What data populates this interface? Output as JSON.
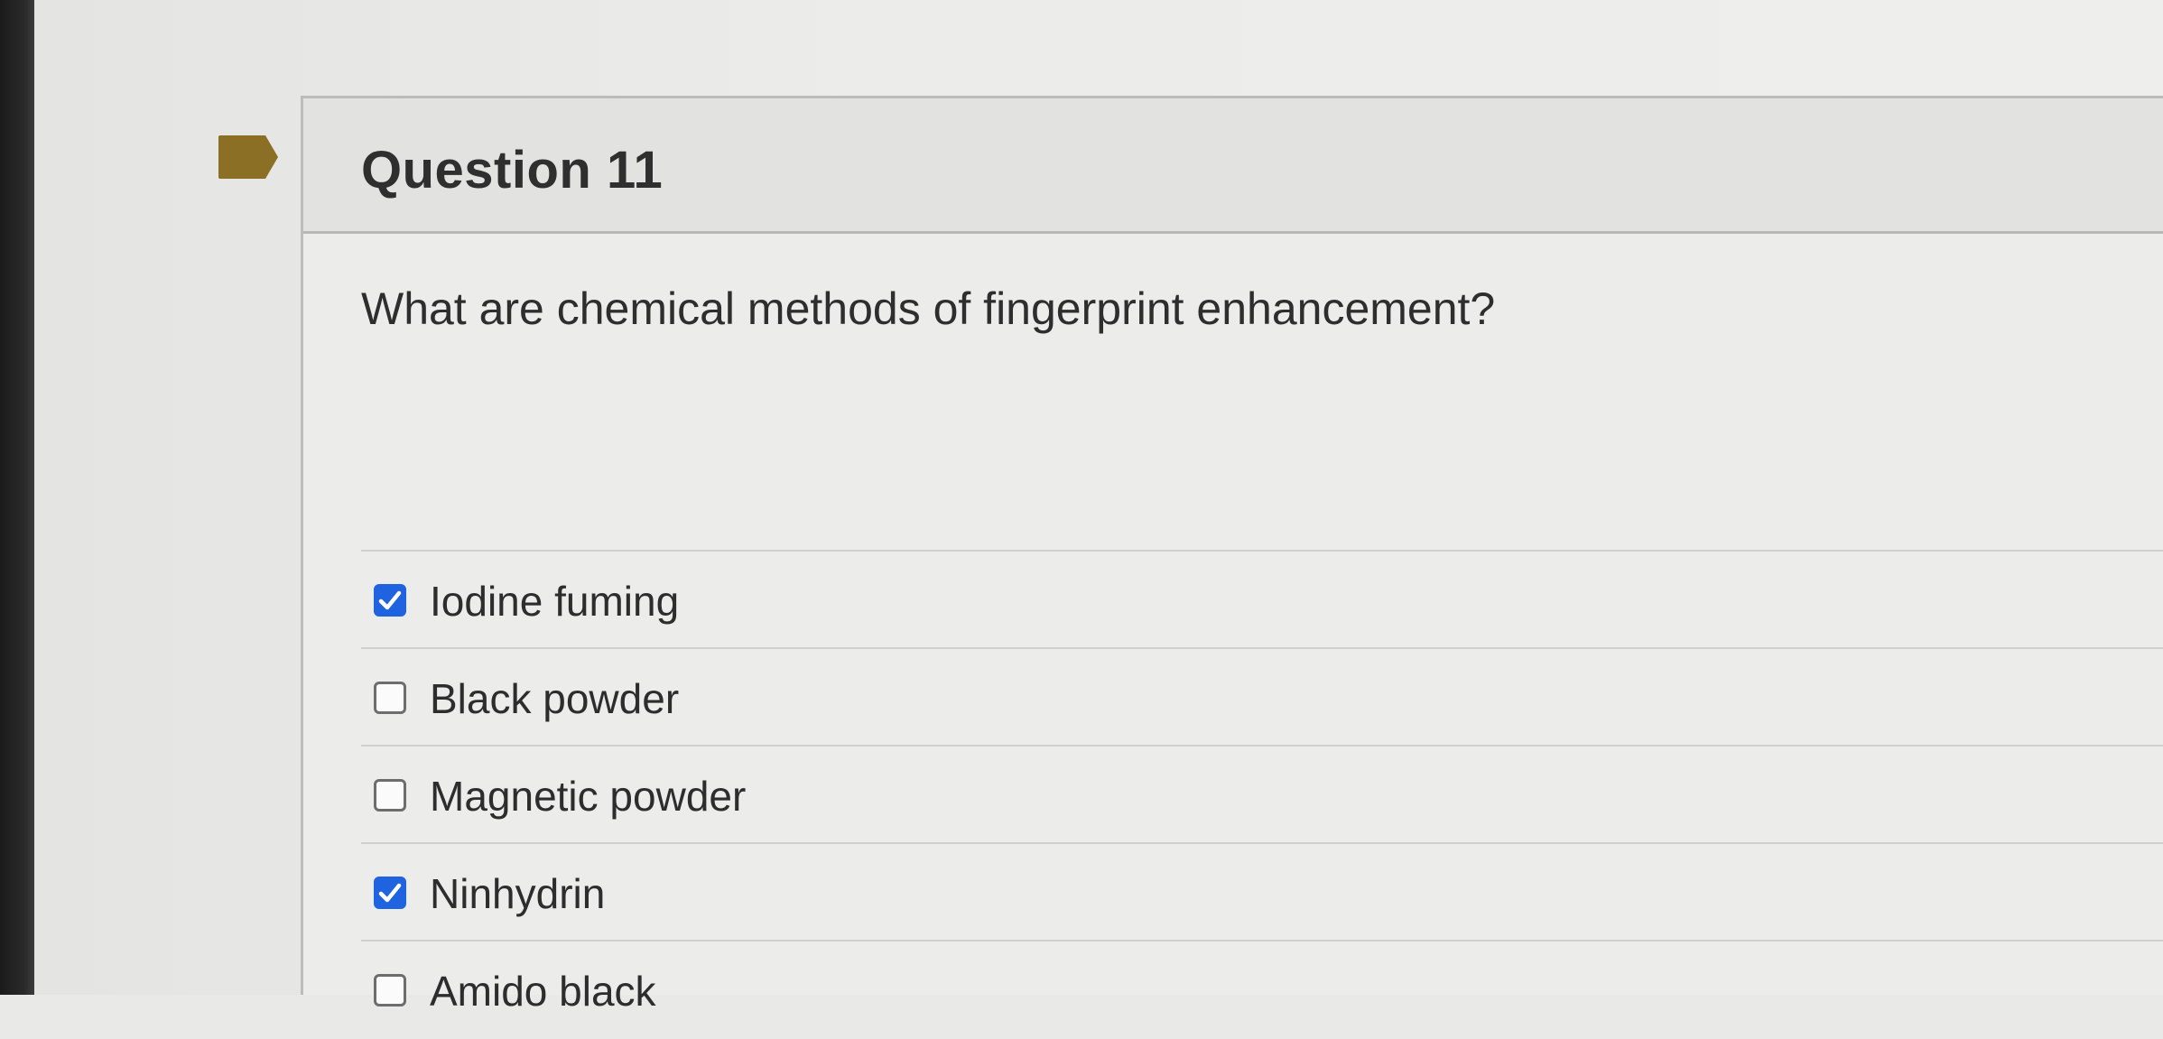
{
  "question": {
    "title": "Question 11",
    "flag_icon": "flag-icon",
    "prompt": "What are chemical methods of fingerprint enhancement?",
    "options": [
      {
        "label": "Iodine fuming",
        "checked": true
      },
      {
        "label": "Black powder",
        "checked": false
      },
      {
        "label": "Magnetic powder",
        "checked": false
      },
      {
        "label": "Ninhydrin",
        "checked": true
      },
      {
        "label": "Amido black",
        "checked": false
      }
    ]
  },
  "colors": {
    "checkbox_checked": "#1f63e0",
    "flag": "#8a6f24"
  }
}
